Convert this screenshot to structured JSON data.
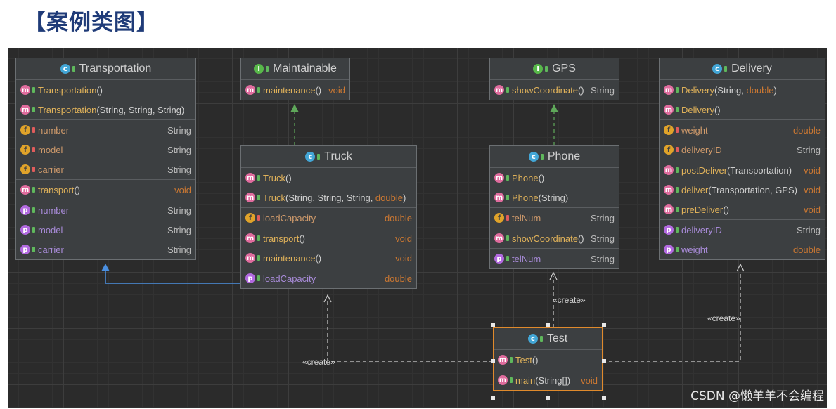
{
  "page_title": "【案例类图】",
  "watermark": "CSDN @懒羊羊不会编程",
  "stereotype": "«create»",
  "classes": {
    "transportation": {
      "name": "Transportation",
      "rows": [
        {
          "icon": "m",
          "vis": "pub",
          "name": "Transportation",
          "params": "()",
          "type": ""
        },
        {
          "icon": "m",
          "vis": "pub",
          "name": "Transportation",
          "params": "(String, String, String)",
          "type": ""
        },
        {
          "icon": "f",
          "vis": "priv",
          "name": "number",
          "params": "",
          "type": "String"
        },
        {
          "icon": "f",
          "vis": "priv",
          "name": "model",
          "params": "",
          "type": "String"
        },
        {
          "icon": "f",
          "vis": "priv",
          "name": "carrier",
          "params": "",
          "type": "String"
        },
        {
          "icon": "m",
          "vis": "pub",
          "name": "transport",
          "params": "()",
          "type": "void"
        },
        {
          "icon": "p",
          "vis": "pub",
          "name": "number",
          "params": "",
          "type": "String"
        },
        {
          "icon": "p",
          "vis": "pub",
          "name": "model",
          "params": "",
          "type": "String"
        },
        {
          "icon": "p",
          "vis": "pub",
          "name": "carrier",
          "params": "",
          "type": "String"
        }
      ]
    },
    "maintainable": {
      "name": "Maintainable",
      "rows": [
        {
          "icon": "m",
          "vis": "pub",
          "name": "maintenance",
          "params": "()",
          "type": "void"
        }
      ]
    },
    "truck": {
      "name": "Truck",
      "rows": [
        {
          "icon": "m",
          "vis": "pub",
          "name": "Truck",
          "params": "()",
          "type": ""
        },
        {
          "icon": "m",
          "vis": "pub",
          "name": "Truck",
          "params": "(String, String, String, double)",
          "type": ""
        },
        {
          "icon": "f",
          "vis": "priv",
          "name": "loadCapacity",
          "params": "",
          "type": "double"
        },
        {
          "icon": "m",
          "vis": "pub",
          "name": "transport",
          "params": "()",
          "type": "void"
        },
        {
          "icon": "m",
          "vis": "pub",
          "name": "maintenance",
          "params": "()",
          "type": "void"
        },
        {
          "icon": "p",
          "vis": "pub",
          "name": "loadCapacity",
          "params": "",
          "type": "double"
        }
      ]
    },
    "gps": {
      "name": "GPS",
      "rows": [
        {
          "icon": "m",
          "vis": "pub",
          "name": "showCoordinate",
          "params": "()",
          "type": "String"
        }
      ]
    },
    "phone": {
      "name": "Phone",
      "rows": [
        {
          "icon": "m",
          "vis": "pub",
          "name": "Phone",
          "params": "()",
          "type": ""
        },
        {
          "icon": "m",
          "vis": "pub",
          "name": "Phone",
          "params": "(String)",
          "type": ""
        },
        {
          "icon": "f",
          "vis": "priv",
          "name": "telNum",
          "params": "",
          "type": "String"
        },
        {
          "icon": "m",
          "vis": "pub",
          "name": "showCoordinate",
          "params": "()",
          "type": "String"
        },
        {
          "icon": "p",
          "vis": "pub",
          "name": "telNum",
          "params": "",
          "type": "String"
        }
      ]
    },
    "delivery": {
      "name": "Delivery",
      "rows": [
        {
          "icon": "m",
          "vis": "pub",
          "name": "Delivery",
          "params": "(String, double)",
          "type": ""
        },
        {
          "icon": "m",
          "vis": "pub",
          "name": "Delivery",
          "params": "()",
          "type": ""
        },
        {
          "icon": "f",
          "vis": "priv",
          "name": "weight",
          "params": "",
          "type": "double"
        },
        {
          "icon": "f",
          "vis": "priv",
          "name": "deliveryID",
          "params": "",
          "type": "String"
        },
        {
          "icon": "m",
          "vis": "pub",
          "name": "postDeliver",
          "params": "(Transportation)",
          "type": "void"
        },
        {
          "icon": "m",
          "vis": "pub",
          "name": "deliver",
          "params": "(Transportation, GPS)",
          "type": "void"
        },
        {
          "icon": "m",
          "vis": "pub",
          "name": "preDeliver",
          "params": "()",
          "type": "void"
        },
        {
          "icon": "p",
          "vis": "pub",
          "name": "deliveryID",
          "params": "",
          "type": "String"
        },
        {
          "icon": "p",
          "vis": "pub",
          "name": "weight",
          "params": "",
          "type": "double"
        }
      ]
    },
    "test": {
      "name": "Test",
      "rows": [
        {
          "icon": "m",
          "vis": "pub",
          "name": "Test",
          "params": "()",
          "type": ""
        },
        {
          "icon": "m",
          "vis": "pub",
          "name": "main",
          "params": "(String[])",
          "type": "void"
        }
      ]
    }
  }
}
